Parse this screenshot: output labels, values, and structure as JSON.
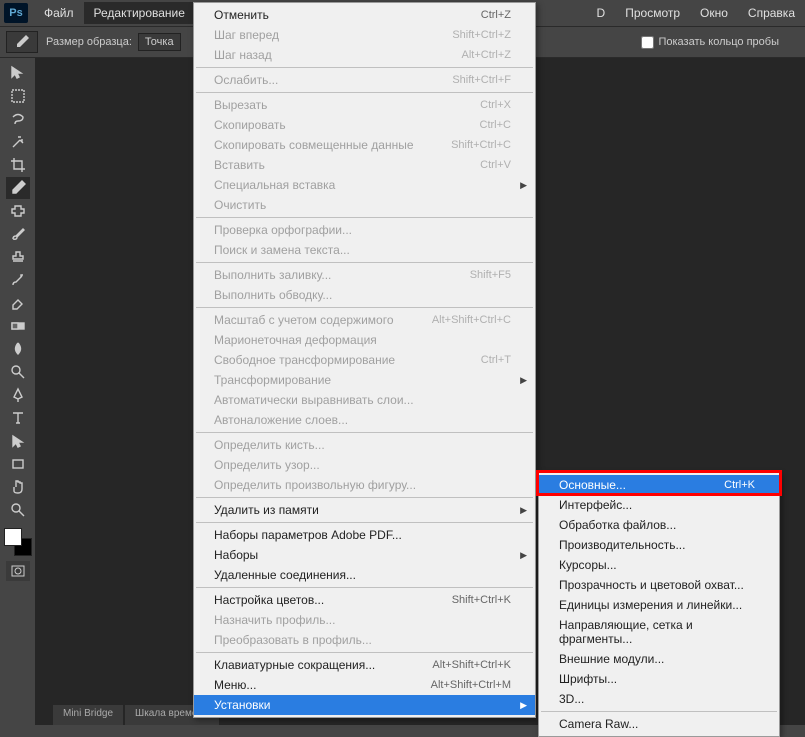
{
  "menubar": {
    "items": [
      "Файл",
      "Редактирование"
    ],
    "right": [
      "D",
      "Просмотр",
      "Окно",
      "Справка"
    ]
  },
  "options": {
    "sample_label": "Размер образца:",
    "sample_value": "Точка",
    "show_ring": "Показать кольцо пробы"
  },
  "dock": {
    "tab1": "Mini Bridge",
    "tab2": "Шкала времени"
  },
  "edit_menu": [
    {
      "type": "item",
      "label": "Отменить",
      "shortcut": "Ctrl+Z",
      "enabled": true
    },
    {
      "type": "item",
      "label": "Шаг вперед",
      "shortcut": "Shift+Ctrl+Z",
      "enabled": false
    },
    {
      "type": "item",
      "label": "Шаг назад",
      "shortcut": "Alt+Ctrl+Z",
      "enabled": false
    },
    {
      "type": "sep"
    },
    {
      "type": "item",
      "label": "Ослабить...",
      "shortcut": "Shift+Ctrl+F",
      "enabled": false
    },
    {
      "type": "sep"
    },
    {
      "type": "item",
      "label": "Вырезать",
      "shortcut": "Ctrl+X",
      "enabled": false
    },
    {
      "type": "item",
      "label": "Скопировать",
      "shortcut": "Ctrl+C",
      "enabled": false
    },
    {
      "type": "item",
      "label": "Скопировать совмещенные данные",
      "shortcut": "Shift+Ctrl+C",
      "enabled": false
    },
    {
      "type": "item",
      "label": "Вставить",
      "shortcut": "Ctrl+V",
      "enabled": false
    },
    {
      "type": "item",
      "label": "Специальная вставка",
      "submenu": true,
      "enabled": false
    },
    {
      "type": "item",
      "label": "Очистить",
      "enabled": false
    },
    {
      "type": "sep"
    },
    {
      "type": "item",
      "label": "Проверка орфографии...",
      "enabled": false
    },
    {
      "type": "item",
      "label": "Поиск и замена текста...",
      "enabled": false
    },
    {
      "type": "sep"
    },
    {
      "type": "item",
      "label": "Выполнить заливку...",
      "shortcut": "Shift+F5",
      "enabled": false
    },
    {
      "type": "item",
      "label": "Выполнить обводку...",
      "enabled": false
    },
    {
      "type": "sep"
    },
    {
      "type": "item",
      "label": "Масштаб с учетом содержимого",
      "shortcut": "Alt+Shift+Ctrl+C",
      "enabled": false
    },
    {
      "type": "item",
      "label": "Марионеточная деформация",
      "enabled": false
    },
    {
      "type": "item",
      "label": "Свободное трансформирование",
      "shortcut": "Ctrl+T",
      "enabled": false
    },
    {
      "type": "item",
      "label": "Трансформирование",
      "submenu": true,
      "enabled": false
    },
    {
      "type": "item",
      "label": "Автоматически выравнивать слои...",
      "enabled": false
    },
    {
      "type": "item",
      "label": "Автоналожение слоев...",
      "enabled": false
    },
    {
      "type": "sep"
    },
    {
      "type": "item",
      "label": "Определить кисть...",
      "enabled": false
    },
    {
      "type": "item",
      "label": "Определить узор...",
      "enabled": false
    },
    {
      "type": "item",
      "label": "Определить произвольную фигуру...",
      "enabled": false
    },
    {
      "type": "sep"
    },
    {
      "type": "item",
      "label": "Удалить из памяти",
      "submenu": true,
      "enabled": true
    },
    {
      "type": "sep"
    },
    {
      "type": "item",
      "label": "Наборы параметров Adobe PDF...",
      "enabled": true
    },
    {
      "type": "item",
      "label": "Наборы",
      "submenu": true,
      "enabled": true
    },
    {
      "type": "item",
      "label": "Удаленные соединения...",
      "enabled": true
    },
    {
      "type": "sep"
    },
    {
      "type": "item",
      "label": "Настройка цветов...",
      "shortcut": "Shift+Ctrl+K",
      "enabled": true
    },
    {
      "type": "item",
      "label": "Назначить профиль...",
      "enabled": false
    },
    {
      "type": "item",
      "label": "Преобразовать в профиль...",
      "enabled": false
    },
    {
      "type": "sep"
    },
    {
      "type": "item",
      "label": "Клавиатурные сокращения...",
      "shortcut": "Alt+Shift+Ctrl+K",
      "enabled": true
    },
    {
      "type": "item",
      "label": "Меню...",
      "shortcut": "Alt+Shift+Ctrl+M",
      "enabled": true
    },
    {
      "type": "item",
      "label": "Установки",
      "submenu": true,
      "enabled": true,
      "highlight": true
    }
  ],
  "prefs_submenu": [
    {
      "label": "Основные...",
      "shortcut": "Ctrl+K",
      "highlight": true
    },
    {
      "label": "Интерфейс..."
    },
    {
      "label": "Обработка файлов..."
    },
    {
      "label": "Производительность..."
    },
    {
      "label": "Курсоры..."
    },
    {
      "label": "Прозрачность и цветовой охват..."
    },
    {
      "label": "Единицы измерения и линейки..."
    },
    {
      "label": "Направляющие, сетка и фрагменты..."
    },
    {
      "label": "Внешние модули..."
    },
    {
      "label": "Шрифты..."
    },
    {
      "label": "3D..."
    },
    {
      "sep": true
    },
    {
      "label": "Camera Raw..."
    }
  ],
  "tools": [
    "move",
    "rect-select",
    "lasso",
    "wand",
    "crop",
    "eyedropper",
    "healing",
    "brush",
    "stamp",
    "history-brush",
    "eraser",
    "gradient",
    "blur",
    "dodge",
    "pen",
    "type",
    "path-select",
    "rectangle",
    "hand",
    "zoom"
  ]
}
